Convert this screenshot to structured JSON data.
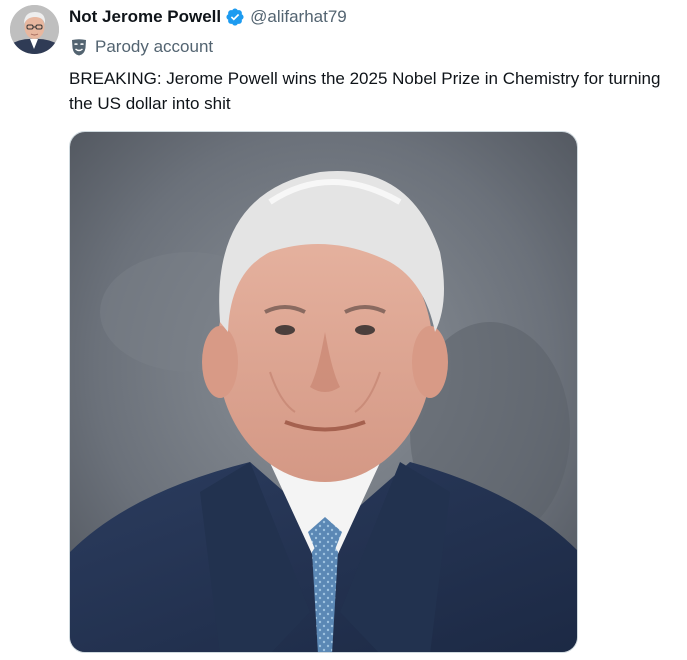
{
  "tweet": {
    "author": {
      "display_name": "Not Jerome Powell",
      "handle": "@alifarhat79",
      "avatar_icon": "avatar-photo",
      "verified_icon": "verified-badge-icon",
      "verified_color": "#1d9bf0"
    },
    "parody_label": "Parody account",
    "parody_icon": "theater-mask-icon",
    "text": "BREAKING: Jerome Powell wins the 2025 Nobel Prize in Chemistry for turning the US dollar into shit",
    "media": {
      "type": "photo",
      "icon": "portrait-photo"
    }
  },
  "colors": {
    "text_primary": "#0f1419",
    "text_secondary": "#536471",
    "accent": "#1d9bf0"
  }
}
